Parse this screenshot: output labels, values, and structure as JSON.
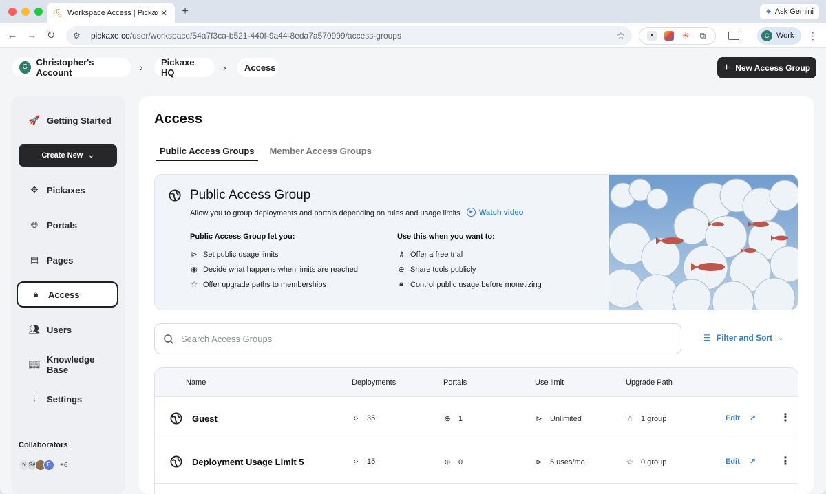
{
  "browser": {
    "tab_title": "Workspace Access | Pickaxe",
    "tab_close": "✕",
    "new_tab": "+",
    "ask_gemini": "Ask Gemini",
    "url_host": "pickaxe.co",
    "url_path": "/user/workspace/54a7f3ca-b521-440f-9a44-8eda7a570999/access-groups",
    "profile_initial": "C",
    "profile_label": "Work"
  },
  "header": {
    "account_initial": "C",
    "account": "Christopher's Account",
    "workspace": "Pickaxe HQ",
    "page": "Access",
    "separator": "›",
    "new_group_label": "New Access Group"
  },
  "sidebar": {
    "getting_started": "Getting Started",
    "create_new": "Create New",
    "items": [
      {
        "label": "Pickaxes",
        "icon": "sparkle-icon"
      },
      {
        "label": "Portals",
        "icon": "globe-icon"
      },
      {
        "label": "Pages",
        "icon": "document-icon"
      },
      {
        "label": "Access",
        "icon": "lock-icon"
      },
      {
        "label": "Users",
        "icon": "users-icon"
      },
      {
        "label": "Knowledge Base",
        "icon": "book-icon"
      },
      {
        "label": "Settings",
        "icon": "sliders-icon"
      }
    ],
    "collaborators_title": "Collaborators",
    "collaborators": [
      "N",
      "SA",
      "",
      "B"
    ],
    "collaborators_more": "+6"
  },
  "main": {
    "title": "Access",
    "tabs": [
      "Public Access Groups",
      "Member Access Groups"
    ],
    "info": {
      "title": "Public Access Group",
      "description": "Allow you to group deployments and portals depending on rules and usage limits",
      "watch_video": "Watch video",
      "left_heading": "Public Access Group let you:",
      "left_points": [
        "Set public usage limits",
        "Decide what happens when limits are reached",
        "Offer upgrade paths to memberships"
      ],
      "right_heading": "Use this when you want to:",
      "right_points": [
        "Offer a free trial",
        "Share tools publicly",
        "Control public usage before monetizing"
      ]
    },
    "search_placeholder": "Search Access Groups",
    "filter_label": "Filter and Sort",
    "table": {
      "columns": [
        "Name",
        "Deployments",
        "Portals",
        "Use limit",
        "Upgrade Path"
      ],
      "edit_label": "Edit",
      "rows": [
        {
          "name": "Guest",
          "deployments": "35",
          "portals": "1",
          "use_limit": "Unlimited",
          "upgrade_path": "1 group"
        },
        {
          "name": "Deployment Usage Limit 5",
          "deployments": "15",
          "portals": "0",
          "use_limit": "5 uses/mo",
          "upgrade_path": "0 group"
        }
      ]
    }
  },
  "colors": {
    "accent_blue": "#3b7fd1",
    "dark_button": "#27272a",
    "avatar_green": "#2f7d6d"
  }
}
